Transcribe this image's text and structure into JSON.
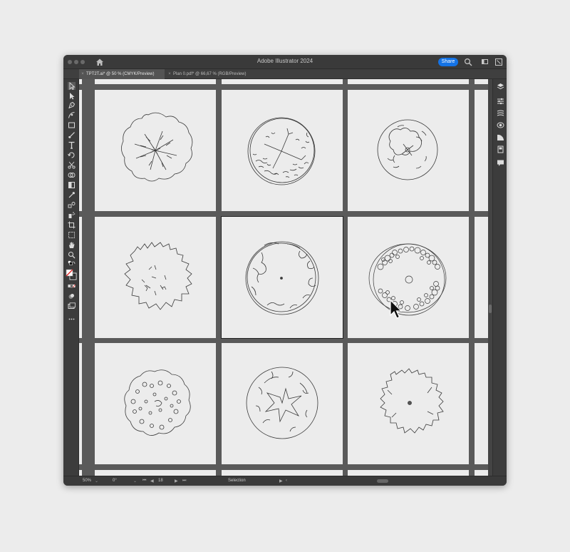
{
  "app": {
    "title": "Adobe Illustrator 2024",
    "share_label": "Share",
    "accent_color": "#1473e6"
  },
  "tabs": [
    {
      "label": "TPT2T.ai* @ 50 % (CMYK/Preview)",
      "active": true
    },
    {
      "label": "Plan 0.pdf* @ 66,67 % (RGB/Preview)",
      "active": false
    }
  ],
  "tabs_close_glyph": "×",
  "artboards": [
    {
      "name": "tree-branching-canopy",
      "selected": false
    },
    {
      "name": "tree-branch-circle-dots",
      "selected": false
    },
    {
      "name": "tree-small-rough-circle",
      "selected": false
    },
    {
      "name": "tree-leafy-outline",
      "selected": false
    },
    {
      "name": "tree-double-ring",
      "selected": true
    },
    {
      "name": "tree-bubbles-ring",
      "selected": false
    },
    {
      "name": "tree-dotted-canopy",
      "selected": false
    },
    {
      "name": "tree-star-center",
      "selected": false
    },
    {
      "name": "tree-jagged-outline",
      "selected": false
    }
  ],
  "toolbar_tools": [
    "selection-tool-icon",
    "direct-selection-tool-icon",
    "pen-tool-icon",
    "curvature-tool-icon",
    "rectangle-tool-icon",
    "paintbrush-tool-icon",
    "type-tool-icon",
    "rotate-tool-icon",
    "scissors-tool-icon",
    "shape-builder-tool-icon",
    "gradient-tool-icon",
    "eyedropper-tool-icon",
    "blend-tool-icon",
    "symbol-sprayer-tool-icon",
    "artboard-tool-icon",
    "slice-tool-icon",
    "hand-tool-icon",
    "zoom-tool-icon"
  ],
  "right_panel_icons": [
    "layers-icon",
    "properties-icon",
    "libraries-icon",
    "appearance-icon",
    "transparency-icon",
    "document-info-icon",
    "comments-icon"
  ],
  "status": {
    "zoom": "50%",
    "rotation": "0°",
    "artboard_number": "18",
    "tool_name": "Selection"
  }
}
